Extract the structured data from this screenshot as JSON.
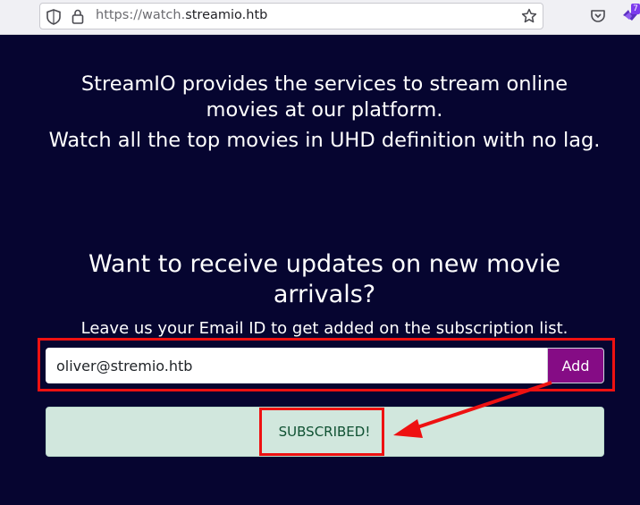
{
  "browser": {
    "url_scheme": "https://watch.",
    "url_domain": "streamio.htb",
    "extension_badge": "7"
  },
  "page": {
    "intro_line1": "StreamIO provides the services to stream online movies at our platform.",
    "intro_line2": "Watch all the top movies in UHD definition with no lag.",
    "subscribe_heading": "Want to receive updates on new movie arrivals?",
    "subscribe_subtext": "Leave us your Email ID to get added on the subscription list.",
    "email_value": "oliver@stremio.htb",
    "add_button_label": "Add",
    "status_message": "SUBSCRIBED!"
  },
  "colors": {
    "background": "#060530",
    "add_button": "#850c85",
    "alert_background": "#d1e7dd",
    "alert_text": "#0f5132",
    "annotation": "#ee1111"
  }
}
